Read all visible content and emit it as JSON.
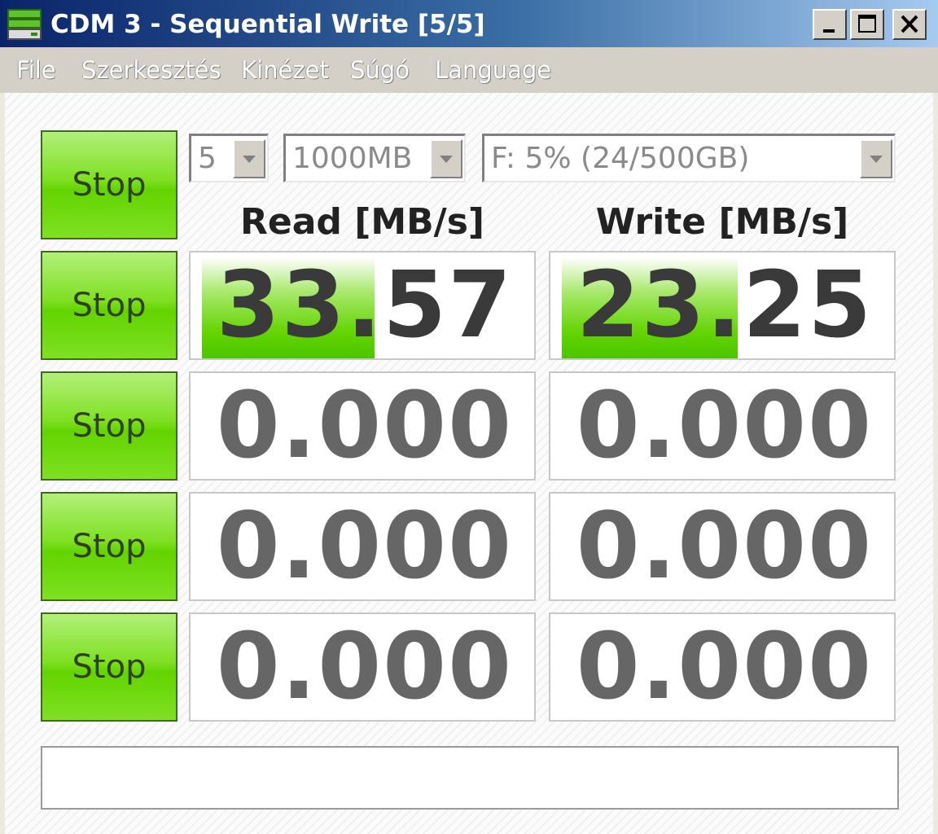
{
  "window": {
    "title": "CDM 3 - Sequential Write [5/5]"
  },
  "menu": [
    {
      "label": "File"
    },
    {
      "label": "Szerkesztés"
    },
    {
      "label": "Kinézet"
    },
    {
      "label": "Súgó"
    },
    {
      "label": "Language"
    }
  ],
  "controls": {
    "all_button_label": "Stop",
    "count": "5",
    "size": "1000MB",
    "drive": "F: 5% (24/500GB)"
  },
  "headers": {
    "read": "Read [MB/s]",
    "write": "Write [MB/s]"
  },
  "rows": [
    {
      "button_label": "Stop",
      "read": "33.57",
      "write": "23.25",
      "read_progress": 0.52,
      "write_progress": 0.53
    },
    {
      "button_label": "Stop",
      "read": "0.000",
      "write": "0.000",
      "read_progress": 0,
      "write_progress": 0
    },
    {
      "button_label": "Stop",
      "read": "0.000",
      "write": "0.000",
      "read_progress": 0,
      "write_progress": 0
    },
    {
      "button_label": "Stop",
      "read": "0.000",
      "write": "0.000",
      "read_progress": 0,
      "write_progress": 0
    }
  ],
  "comment": "",
  "colors": {
    "accent_green": "#62d400",
    "titlebar_dark": "#0a246a",
    "titlebar_light": "#a6caf0"
  },
  "icons": [
    "app-drive-icon",
    "minimize-icon",
    "maximize-icon",
    "close-icon",
    "dropdown-arrow-icon"
  ]
}
